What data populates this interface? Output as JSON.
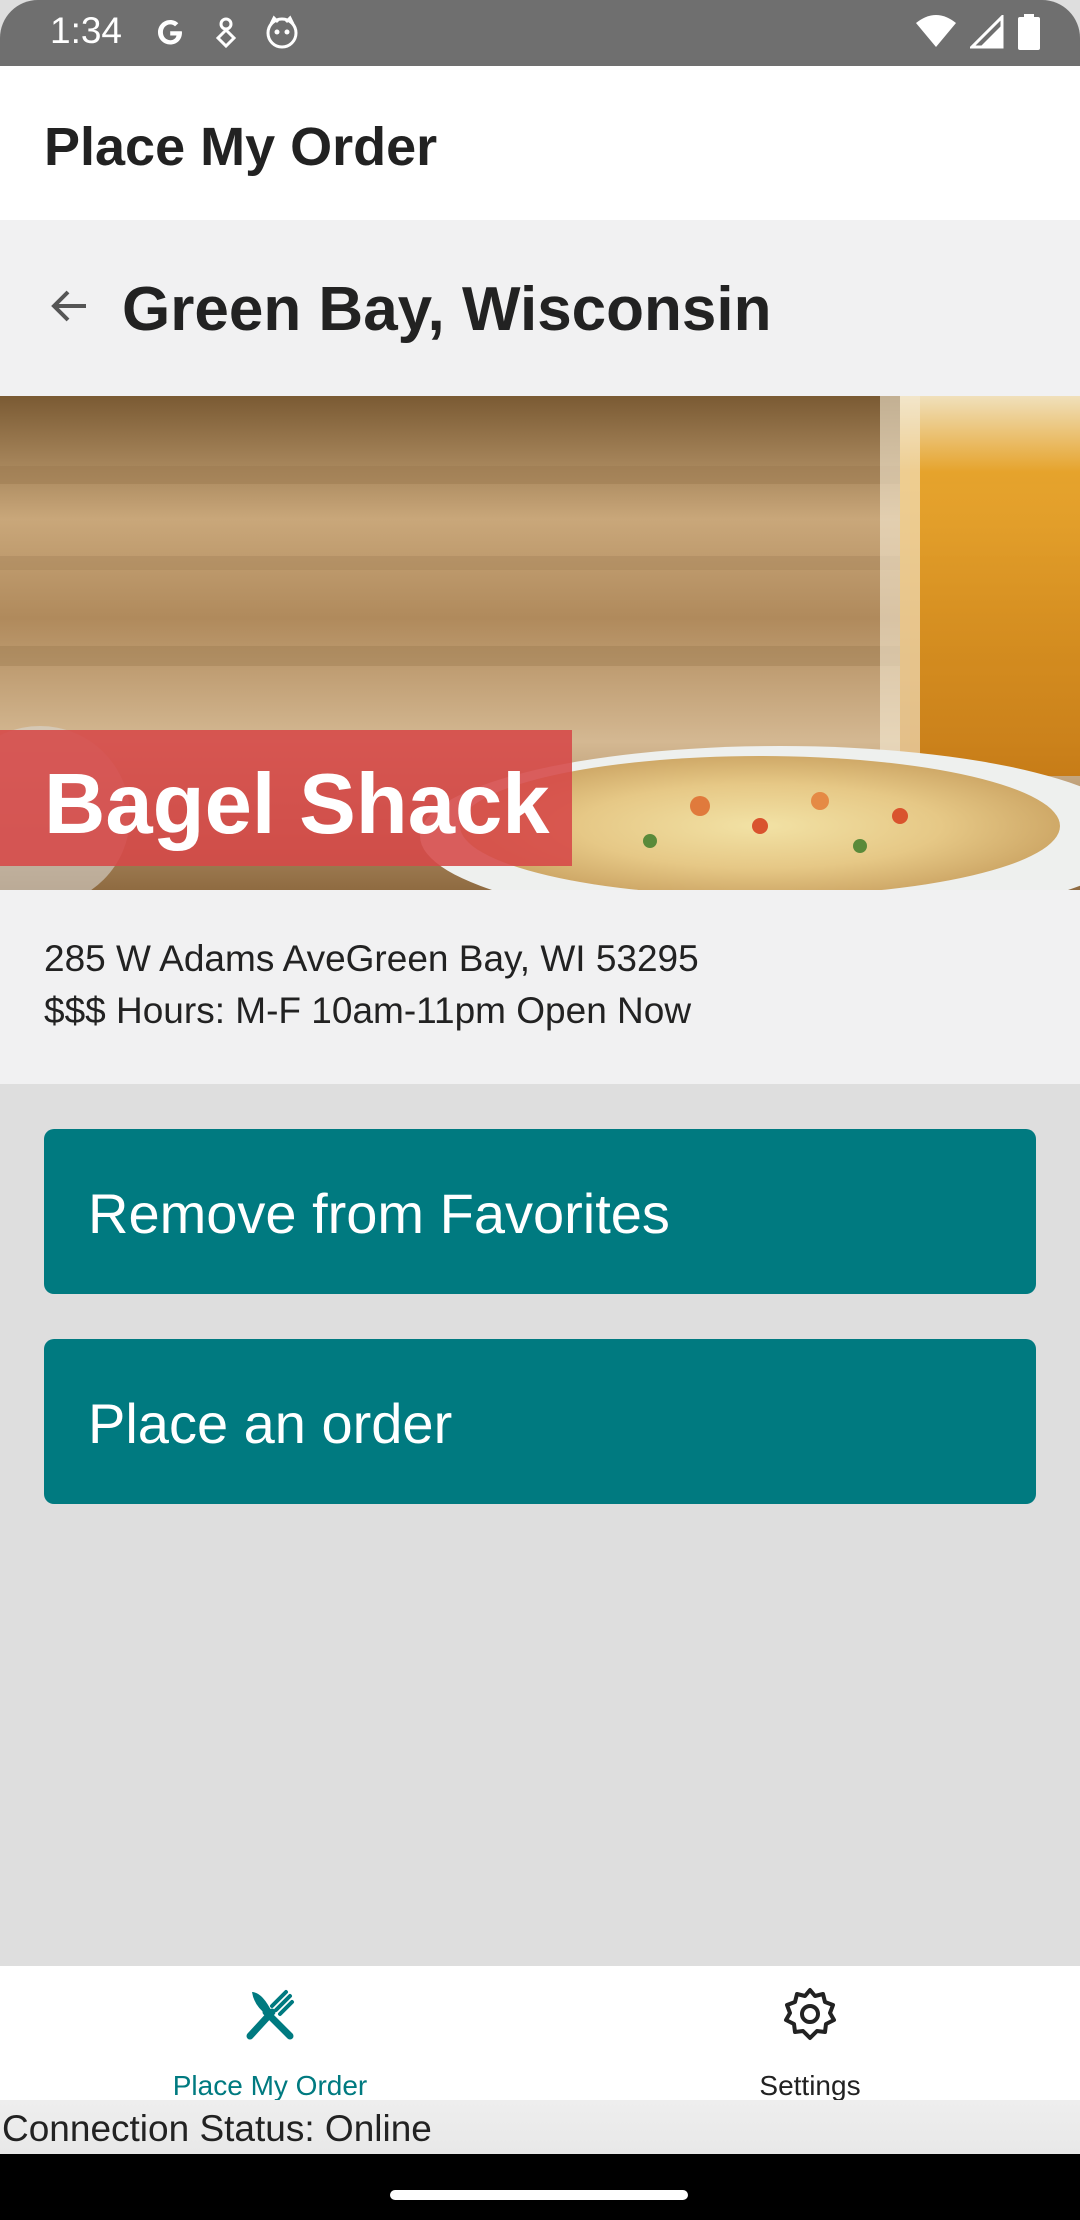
{
  "status_bar": {
    "time": "1:34",
    "left_icons": [
      "google-icon",
      "pin-icon",
      "cat-face-icon"
    ],
    "right_icons": [
      "wifi-icon",
      "signal-icon",
      "battery-icon"
    ]
  },
  "app_bar": {
    "title": "Place My Order"
  },
  "location_header": {
    "title": "Green Bay, Wisconsin",
    "back_icon": "arrow-left-icon"
  },
  "restaurant": {
    "name": "Bagel Shack",
    "address": "285 W Adams AveGreen Bay, WI 53295",
    "hours": "$$$ Hours: M-F 10am-11pm Open Now"
  },
  "actions": {
    "favorites_label": "Remove from Favorites",
    "order_label": "Place an order"
  },
  "bottom_nav": {
    "items": [
      {
        "label": "Place My Order",
        "icon": "fork-knife-icon",
        "active": true
      },
      {
        "label": "Settings",
        "icon": "gear-icon",
        "active": false
      }
    ]
  },
  "connection_status": "Connection Status: Online",
  "colors": {
    "accent": "#007a80",
    "banner": "#d64848",
    "header_bg": "#f1f1f2",
    "page_bg": "#dedede"
  }
}
